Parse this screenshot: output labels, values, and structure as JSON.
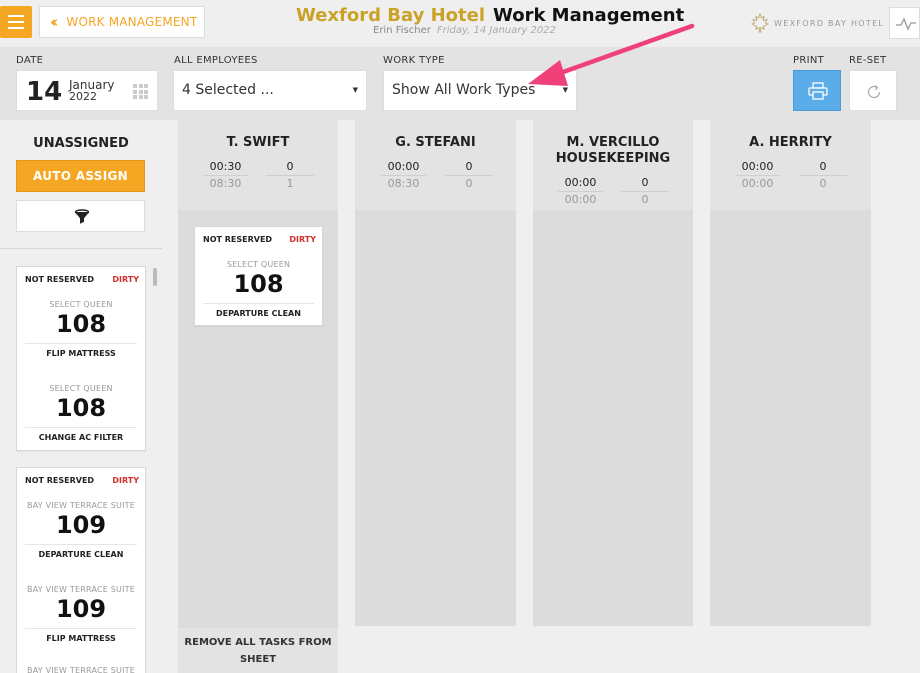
{
  "header": {
    "back_label": "WORK MANAGEMENT",
    "hotel_name": "Wexford Bay Hotel",
    "app_title": "Work Management",
    "user_name": "Erin Fischer",
    "current_date": "Friday, 14 January 2022",
    "brand_text": "WEXFORD BAY HOTEL"
  },
  "filters": {
    "date_label": "DATE",
    "date_day": "14",
    "date_month": "January",
    "date_year": "2022",
    "employees_label": "ALL EMPLOYEES",
    "employees_value": "4 Selected ...",
    "work_type_label": "WORK TYPE",
    "work_type_value": "Show All Work Types",
    "print_label": "PRINT",
    "reset_label": "RE-SET"
  },
  "sidebar": {
    "title": "UNASSIGNED",
    "auto_assign_label": "AUTO ASSIGN",
    "cards": [
      {
        "status": "NOT RESERVED",
        "flag": "DIRTY",
        "tasks": [
          {
            "room_type": "SELECT QUEEN",
            "room": "108",
            "task": "FLIP MATTRESS"
          },
          {
            "room_type": "SELECT QUEEN",
            "room": "108",
            "task": "CHANGE AC FILTER"
          }
        ]
      },
      {
        "status": "NOT RESERVED",
        "flag": "DIRTY",
        "tasks": [
          {
            "room_type": "BAY VIEW TERRACE SUITE",
            "room": "109",
            "task": "DEPARTURE CLEAN"
          },
          {
            "room_type": "BAY VIEW TERRACE SUITE",
            "room": "109",
            "task": "FLIP MATTRESS"
          },
          {
            "room_type": "BAY VIEW TERRACE SUITE",
            "room": "",
            "task": ""
          }
        ]
      }
    ]
  },
  "columns": [
    {
      "name": "T. SWIFT",
      "time_assigned": "00:30",
      "count_assigned": "0",
      "time_total": "08:30",
      "count_total": "1",
      "cards": [
        {
          "status": "NOT RESERVED",
          "flag": "DIRTY",
          "tasks": [
            {
              "room_type": "SELECT QUEEN",
              "room": "108",
              "task": "DEPARTURE CLEAN"
            }
          ]
        }
      ]
    },
    {
      "name": "G. STEFANI",
      "time_assigned": "00:00",
      "count_assigned": "0",
      "time_total": "08:30",
      "count_total": "0",
      "cards": []
    },
    {
      "name": "M. VERCILLO HOUSEKEEPING",
      "time_assigned": "00:00",
      "count_assigned": "0",
      "time_total": "00:00",
      "count_total": "0",
      "cards": []
    },
    {
      "name": "A. HERRITY",
      "time_assigned": "00:00",
      "count_assigned": "0",
      "time_total": "00:00",
      "count_total": "0",
      "cards": []
    }
  ],
  "remove_all_label": "REMOVE ALL TASKS FROM SHEET",
  "colors": {
    "accent_orange": "#f5a623",
    "hotel_gold": "#c9a227",
    "dirty_red": "#d0312d",
    "print_blue": "#5aade8",
    "annotation_pink": "#f0407a"
  },
  "icons": {
    "menu": "hamburger-icon",
    "back": "double-chevron-left-icon",
    "brand": "maple-leaf-icon",
    "pulse": "pulse-line-icon",
    "calendar": "calendar-grid-icon",
    "print": "printer-icon",
    "reset": "reset-arrow-icon",
    "filter": "funnel-icon",
    "annotation": "pink-arrow-icon"
  }
}
